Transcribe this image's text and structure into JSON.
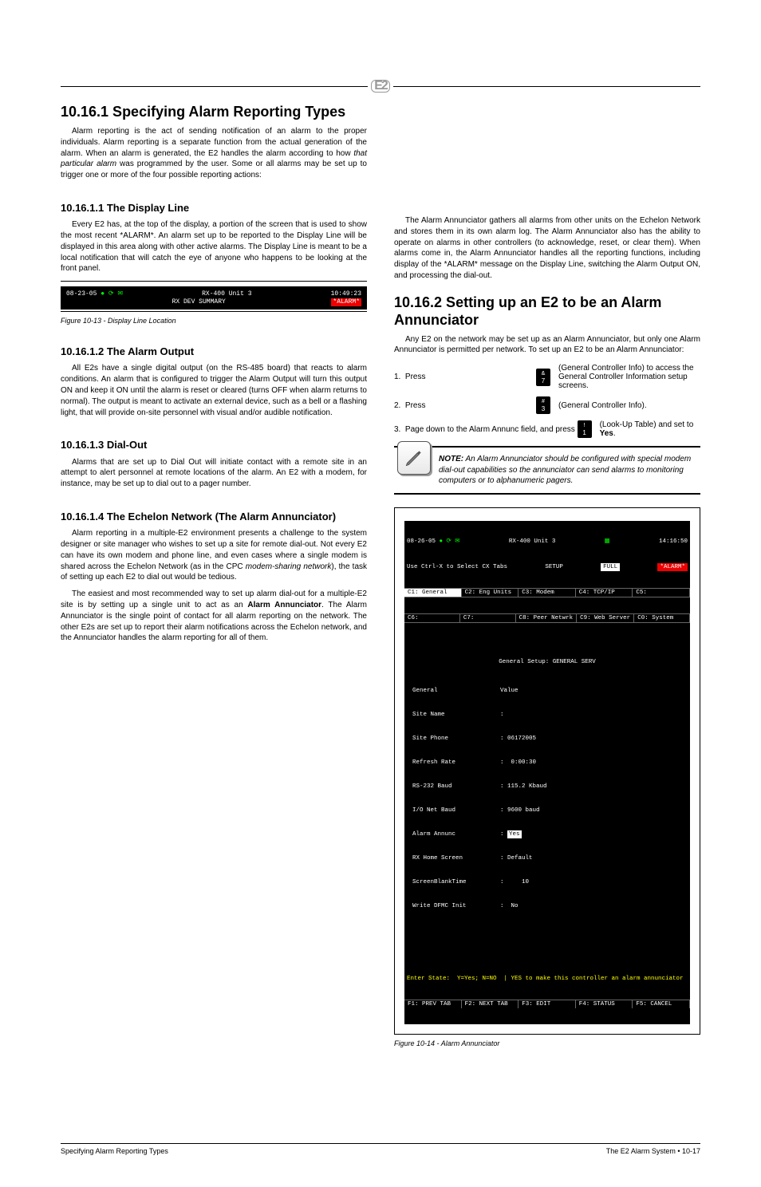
{
  "header": {
    "logo": "E2"
  },
  "left": {
    "h2": "10.16.1  Specifying Alarm Reporting Types",
    "p1a": "Alarm reporting is the act of sending notification of an alarm to the proper individuals. Alarm reporting is a separate function from the actual generation of the alarm. When an alarm is generated, the E2 handles the alarm according to how ",
    "p1b": "that particular alarm",
    "p1c": " was programmed by the user. Some or all alarms may be set up to trigger one or more of the four possible reporting actions:",
    "h3_1": "10.16.1.1  The Display Line",
    "p2a": "Every E2 has, at the top of the display, a portion of the screen that is used to show the most recent ",
    "p2b": "*ALARM*",
    "p2c": ". An alarm set up to be reported to the Display Line will be displayed in this area along with other active alarms. The Display Line is meant to be a local notification that will catch the eye of anyone who happens to be looking at the front panel.",
    "term_small": {
      "date": "08-23-05 ",
      "unit": "RX-400 Unit 3",
      "time": "10:49:23",
      "sub": "RX DEV SUMMARY",
      "alarm": "*ALARM*"
    },
    "figcap1": "Figure 10-13 - Display Line Location",
    "h3_2": "10.16.1.2  The Alarm Output",
    "p3": "All E2s have a single digital output (on the RS-485 board) that reacts to alarm conditions. An alarm that is configured to trigger the Alarm Output will turn this output ON and keep it ON until the alarm is reset or cleared (turns OFF when alarm returns to normal). The output is meant to activate an external device, such as a bell or a flashing light, that will provide on-site personnel with visual and/or audible notification.",
    "h3_3": "10.16.1.3  Dial-Out",
    "p4": "Alarms that are set up to Dial Out will initiate contact with a remote site in an attempt to alert personnel at remote locations of the alarm. An E2 with a modem, for instance, may be set up to dial out to a pager number.",
    "h3_4": "10.16.1.4  The Echelon Network (The Alarm Annunciator)",
    "p5a": "Alarm reporting in a multiple-E2 environment presents a challenge to the system designer or site manager who wishes to set up a site for remote dial-out. Not every E2 can have its own modem and phone line, and even cases where a single modem is shared across the Echelon Network (as in the CPC ",
    "p5b": "modem-sharing network",
    "p5c": "), the task of setting up each E2 to dial out would be tedious.",
    "p6a": "The easiest and most recommended way to set up alarm dial-out for a multiple-E2 site is by setting up a single unit to act as an ",
    "p6b": "Alarm Annunciator",
    "p6c": ". The Alarm Annunciator is the single point of contact for all alarm reporting on the network. The other E2s are set up to report their alarm notifications across the Echelon network, and the Annunciator handles the alarm reporting for all of them."
  },
  "right": {
    "p7": "The Alarm Annunciator gathers all alarms from other units on the Echelon Network and stores them in its own alarm log. The Alarm Annunciator also has the ability to operate on alarms in other controllers (to acknowledge, reset, or clear them). When alarms come in, the Alarm Annunciator handles all the reporting functions, including display of the *ALARM* message on the Display Line, switching the Alarm Output ON, and processing the dial-out.",
    "h2": "10.16.2  Setting up an E2 to be an Alarm Annunciator",
    "p8": "Any E2 on the network may be set up as an Alarm Annunciator, but only one Alarm Annunciator is permitted per network. To set up an E2 to be an Alarm Annunciator:",
    "steps": [
      "1.  Press           (General Controller Info) to access the General Controller Information setup screens.",
      "2.  Press           (General Controller Info).",
      "3.  Page down to the Alarm Annunc field, and press           (Look-Up Table) and set to Yes."
    ],
    "keycaps": [
      {
        "top": "&",
        "bottom": "7"
      },
      {
        "top": "#",
        "bottom": "3"
      },
      {
        "top": "!",
        "bottom": "1"
      }
    ],
    "note_label": "NOTE:",
    "note_text": " An Alarm Annunciator should be configured with special modem dial-out capabilities so the annunciator can send alarms to monitoring computers or to alphanumeric pagers.",
    "term_big": {
      "date": "08-26-05 ",
      "unit": "RX-400 Unit 3",
      "time": "14:16:50",
      "line2_left": "Use Ctrl-X to Select CX Tabs",
      "line2_mid": "SETUP",
      "full": "FULL",
      "alarm": "*ALARM*",
      "tabs1": [
        "C1: General",
        "C2: Eng Units",
        "C3: Modem",
        "C4: TCP/IP",
        "C5:"
      ],
      "tabs2": [
        "C6:",
        "C7:",
        "C8: Peer Netwrk",
        "C9: Web Server",
        "C0: System"
      ],
      "midtitle": "General Setup: GENERAL SERV",
      "fields": [
        [
          "General",
          "Value"
        ],
        [
          "Site Name",
          ":"
        ],
        [
          "Site Phone",
          ": 06172005"
        ],
        [
          "Refresh Rate",
          ":  0:00:30"
        ],
        [
          "RS-232 Baud",
          ": 115.2 Kbaud"
        ],
        [
          "I/O Net Baud",
          ": 9600 baud"
        ],
        [
          "Alarm Annunc",
          ": "
        ],
        [
          "RX Home Screen",
          ": Default"
        ],
        [
          "ScreenBlankTime",
          ":     10"
        ],
        [
          "Write DFMC Init",
          ":  No"
        ]
      ],
      "alarm_annunc_val": "Yes",
      "hint": "Enter State:  Y=Yes; N=NO  | YES to make this controller an alarm annunciator",
      "fkeys": [
        "F1: PREV TAB",
        "F2: NEXT TAB",
        "F3: EDIT",
        "F4: STATUS",
        "F5: CANCEL"
      ]
    },
    "figcap2": "Figure 10-14 - Alarm Annunciator"
  },
  "footer": {
    "left": "Specifying Alarm Reporting Types",
    "mid": "The E2 Alarm System  •  10-17"
  }
}
